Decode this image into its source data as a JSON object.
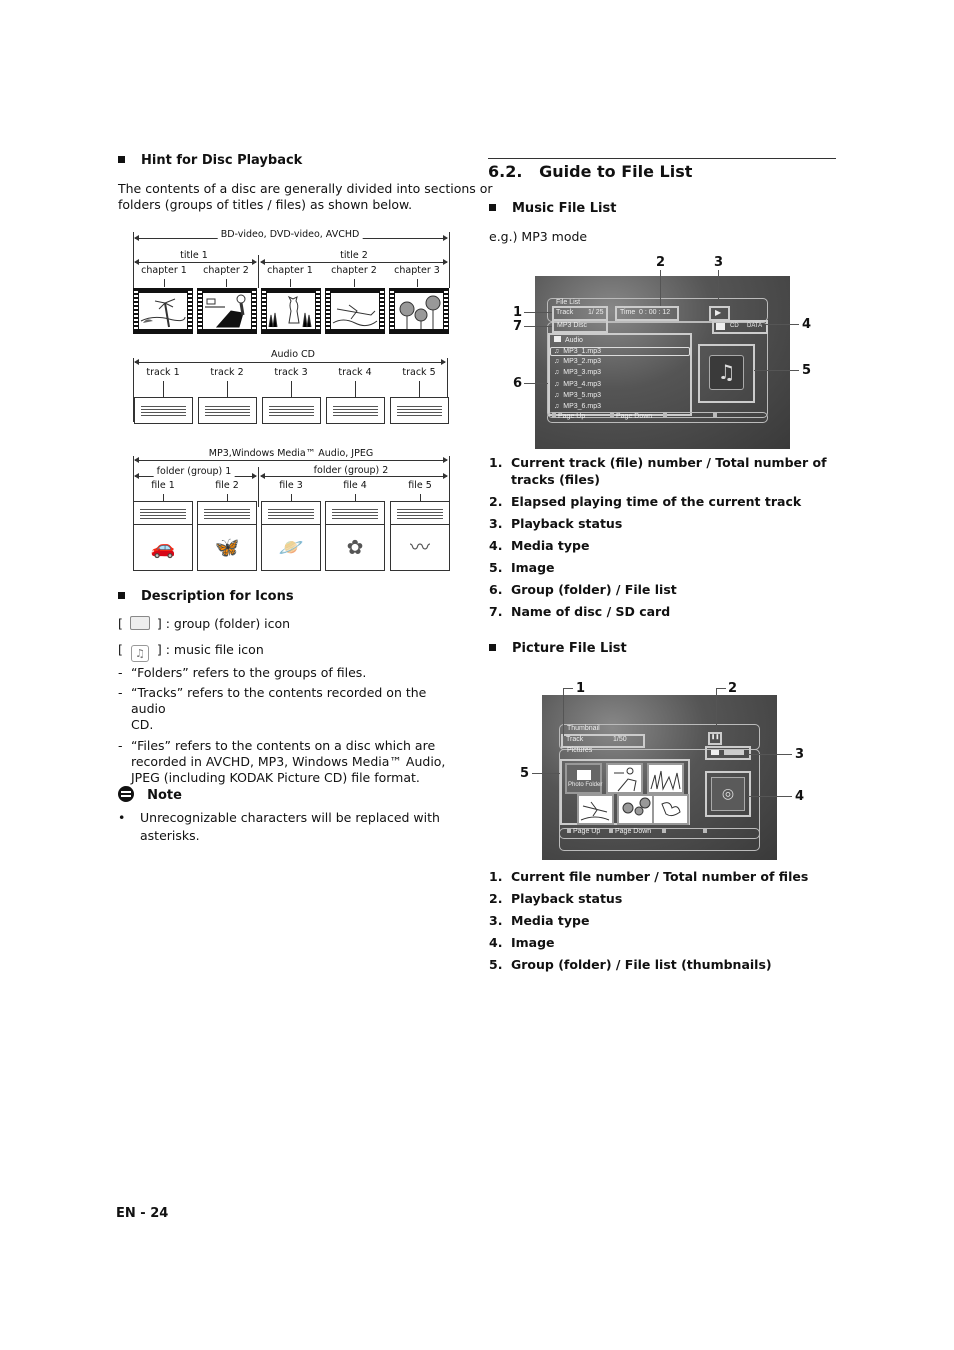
{
  "left": {
    "hint": {
      "heading": "Hint for Disc Playback",
      "paragraph_line1": "The contents of a disc are generally divided into sections or",
      "paragraph_line2": "folders (groups of titles / files) as shown below."
    },
    "diagram_video": {
      "label": "BD-video, DVD-video, AVCHD",
      "titles": [
        "title 1",
        "title 2"
      ],
      "chapters": [
        "chapter 1",
        "chapter 2",
        "chapter 1",
        "chapter 2",
        "chapter 3"
      ],
      "images": [
        "beach-palm-image",
        "person-chair-image",
        "cat-grass-image",
        "airplane-image",
        "sunflowers-image"
      ]
    },
    "diagram_cd": {
      "label": "Audio CD",
      "tracks": [
        "track 1",
        "track 2",
        "track 3",
        "track 4",
        "track 5"
      ]
    },
    "diagram_files": {
      "label": "MP3,Windows Media™ Audio, JPEG",
      "folders": [
        "folder (group) 1",
        "folder (group) 2"
      ],
      "files": [
        "file 1",
        "file 2",
        "file 3",
        "file 4",
        "file 5"
      ],
      "images": [
        "car-image",
        "butterfly-image",
        "planet-stars-image",
        "flowers-image",
        "caterpillar-image"
      ]
    },
    "icons": {
      "heading": "Description for Icons",
      "folder_icon_text": "] : group (folder) icon",
      "music_icon_text": "] : music file icon",
      "bracket": "[",
      "bullets": [
        "“Folders” refers to the groups of files.",
        "“Tracks” refers to the contents recorded on the audio",
        "CD.",
        "“Files” refers to the contents on a disc which are",
        "recorded in AVCHD, MP3, Windows Media™ Audio,",
        "JPEG (including KODAK Picture CD) file format."
      ],
      "dash": "-"
    },
    "note": {
      "heading": "Note",
      "bullet_mark": "•",
      "line1": "Unrecognizable characters will be replaced with",
      "line2": "asterisks."
    },
    "page_number": "EN - 24"
  },
  "right": {
    "section_title": "6.2.   Guide to File List",
    "music": {
      "heading": "Music File List",
      "example": "e.g.) MP3 mode",
      "screen": {
        "title": "File List",
        "track_label": "Track",
        "track_value": "1/ 25",
        "time_label": "Time",
        "time_value": "0 : 00 : 12",
        "play_symbol": "▶",
        "disc_name": "MP3   Disc",
        "media_cd": "CD",
        "media_data": "DATA",
        "folder": "Audio",
        "files": [
          "MP3_1.mp3",
          "MP3_2.mp3",
          "MP3_3.mp3",
          "MP3_4.mp3",
          "MP3_5.mp3",
          "MP3_6.mp3"
        ],
        "selected_index": 0,
        "footer": [
          "Page Up",
          "Page Down",
          "",
          ""
        ]
      },
      "callouts": [
        "1",
        "2",
        "3",
        "4",
        "5",
        "6",
        "7"
      ],
      "list": [
        {
          "n": "1.",
          "t": "Current track (file) number / Total number of",
          "t2": "tracks (files)"
        },
        {
          "n": "2.",
          "t": "Elapsed playing time of the current track"
        },
        {
          "n": "3.",
          "t": "Playback status"
        },
        {
          "n": "4.",
          "t": "Media type"
        },
        {
          "n": "5.",
          "t": "Image"
        },
        {
          "n": "6.",
          "t": "Group (folder) / File list"
        },
        {
          "n": "7.",
          "t": "Name of disc / SD card"
        }
      ]
    },
    "picture": {
      "heading": "Picture File List",
      "screen": {
        "title": "Thumbnail",
        "track_label": "Track",
        "track_value": "1/50",
        "pause_symbol": "❚❚",
        "group": "Pictures",
        "folder_thumb": "Photo Folder",
        "footer": [
          "Page Up",
          "Page Down",
          "",
          ""
        ]
      },
      "callouts": [
        "1",
        "2",
        "3",
        "4",
        "5"
      ],
      "list": [
        {
          "n": "1.",
          "t": "Current file number / Total number of files"
        },
        {
          "n": "2.",
          "t": "Playback status"
        },
        {
          "n": "3.",
          "t": "Media type"
        },
        {
          "n": "4.",
          "t": "Image"
        },
        {
          "n": "5.",
          "t": "Group (folder) / File list (thumbnails)"
        }
      ]
    }
  }
}
